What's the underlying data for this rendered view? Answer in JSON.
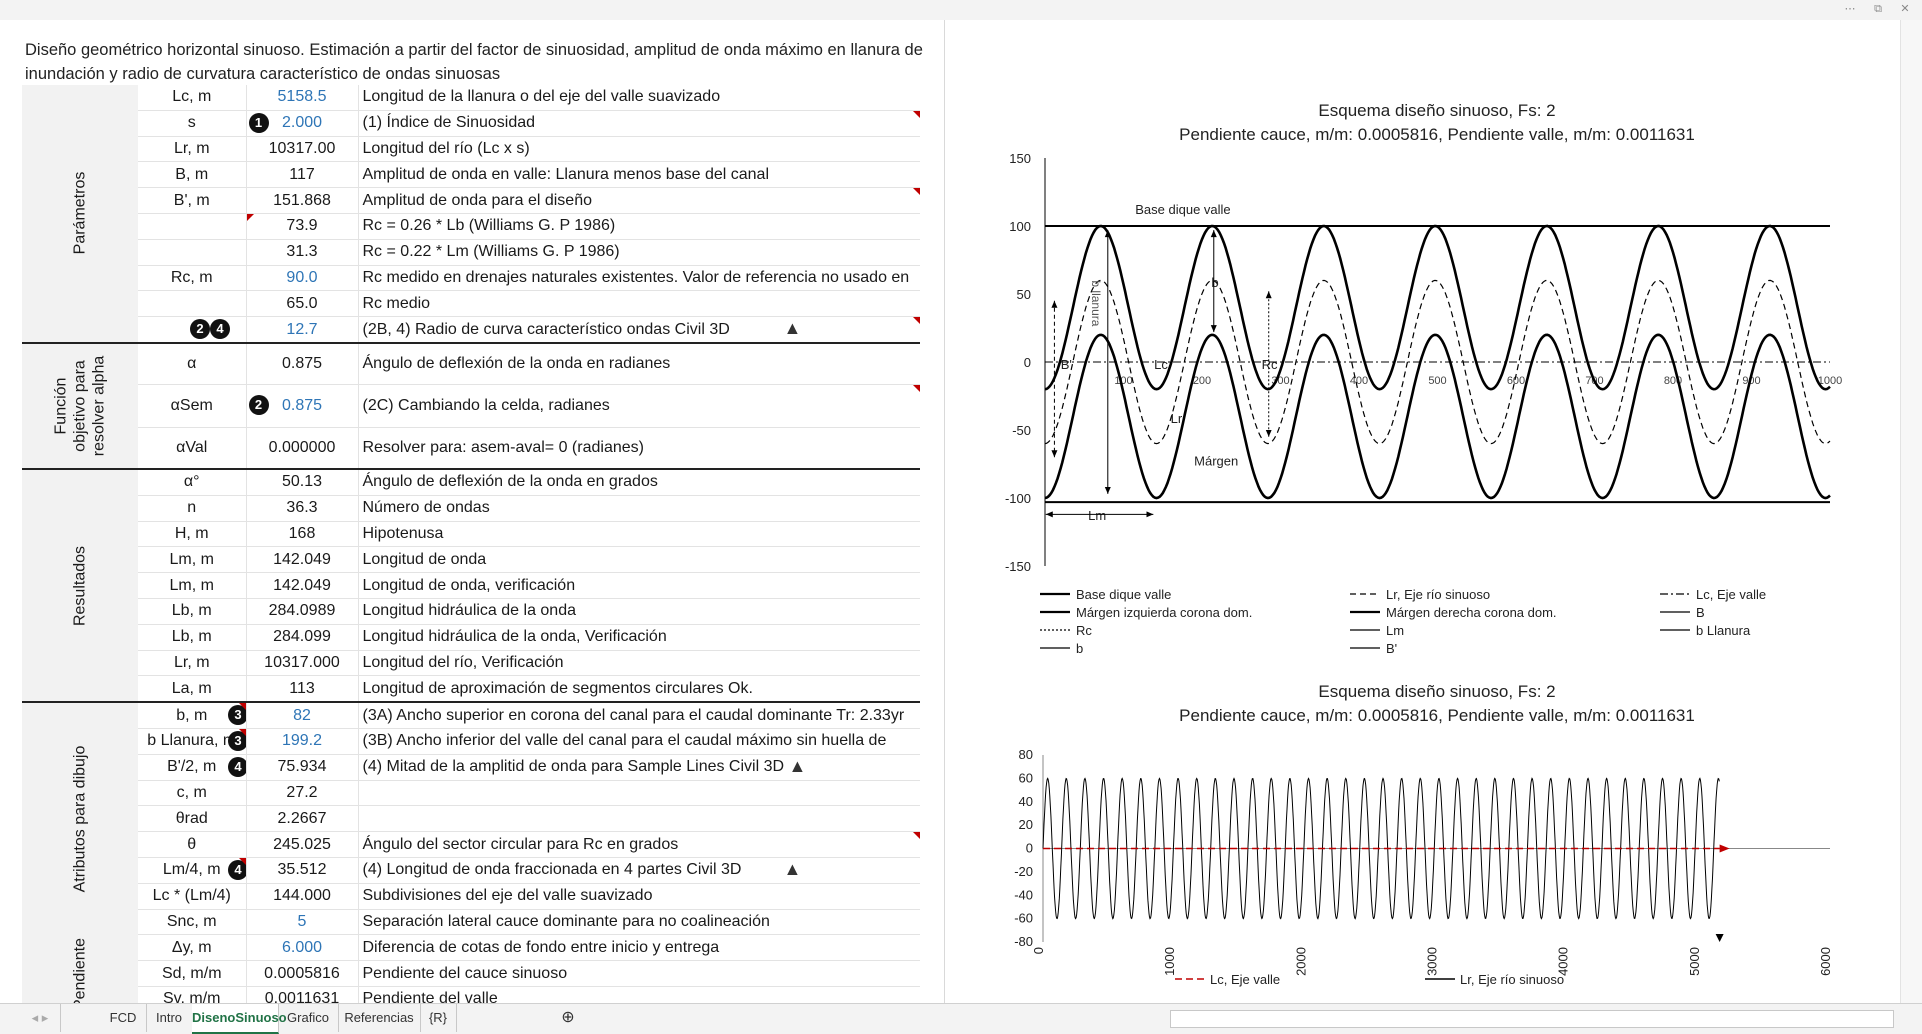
{
  "window": {
    "minimize": "⋯",
    "restore": "⧉",
    "close": "✕"
  },
  "title": "Diseño geométrico horizontal sinuoso. Estimación a partir del factor de sinuosidad, amplitud de onda máximo en llanura de inundación y radio de curvatura característico de ondas sinuosas",
  "sections": {
    "parametros": "Parámetros",
    "funcion": "Función objetivo para resolver alpha",
    "resultados": "Resultados",
    "atributos": "Atributos para dibujo",
    "pendiente": "Pendiente"
  },
  "rows": [
    {
      "label": "Lc, m",
      "value": "5158.5",
      "desc": "Longitud de la llanura o del eje del valle suavizado",
      "blue": true
    },
    {
      "label": "s",
      "value": "2.000",
      "desc": "(1) Índice de Sinuosidad",
      "blue": true,
      "mark": "1"
    },
    {
      "label": "Lr, m",
      "value": "10317.00",
      "desc": "Longitud del río (Lc x s)"
    },
    {
      "label": "B, m",
      "value": "117",
      "desc": "Amplitud de onda en valle: Llanura menos base del canal"
    },
    {
      "label": "B', m",
      "value": "151.868",
      "desc": "Amplitud de onda para el diseño"
    },
    {
      "label": "",
      "value": "73.9",
      "desc": "Rc = 0.26 * Lb (Williams G. P 1986)"
    },
    {
      "label": "",
      "value": "31.3",
      "desc": "Rc = 0.22 * Lm (Williams G. P 1986)"
    },
    {
      "label": "Rc, m",
      "value": "90.0",
      "desc": "Rc medido en drenajes naturales existentes. Valor de referencia no usado en",
      "blue": true
    },
    {
      "label": "",
      "value": "65.0",
      "desc": "Rc medio"
    },
    {
      "label": "",
      "value": "12.7",
      "desc": "(2B, 4) Radio de curva característico ondas Civil 3D",
      "blue": true,
      "mark": "2 4"
    },
    {
      "label": "α",
      "value": "0.875",
      "desc": "Ángulo de deflexión de la onda en radianes"
    },
    {
      "label": "αSem",
      "value": "0.875",
      "desc": "(2C) Cambiando la celda, radianes",
      "blue": true,
      "mark": "2"
    },
    {
      "label": "αVal",
      "value": "0.000000",
      "desc": "Resolver para: asem-aval= 0 (radianes)"
    },
    {
      "label": "α°",
      "value": "50.13",
      "desc": "Ángulo de deflexión de la onda en grados"
    },
    {
      "label": "n",
      "value": "36.3",
      "desc": "Número de ondas"
    },
    {
      "label": "H, m",
      "value": "168",
      "desc": "Hipotenusa"
    },
    {
      "label": "Lm, m",
      "value": "142.049",
      "desc": "Longitud de onda"
    },
    {
      "label": "Lm, m",
      "value": "142.049",
      "desc": "Longitud de onda, verificación"
    },
    {
      "label": "Lb, m",
      "value": "284.0989",
      "desc": "Longitud hidráulica de la onda"
    },
    {
      "label": "Lb, m",
      "value": "284.099",
      "desc": "Longitud hidráulica de la onda, Verificación"
    },
    {
      "label": "Lr, m",
      "value": "10317.000",
      "desc": "Longitud del río, Verificación"
    },
    {
      "label": "La, m",
      "value": "113",
      "desc": "Longitud de aproximación de segmentos circulares Ok."
    },
    {
      "label": "b, m",
      "value": "82",
      "desc": "(3A) Ancho superior en corona del canal para el caudal dominante Tr: 2.33yr",
      "blue": true,
      "mark": "3"
    },
    {
      "label": "b Llanura, m",
      "value": "199.2",
      "desc": "(3B) Ancho inferior del valle del canal para el caudal máximo sin huella de",
      "blue": true,
      "mark": "3"
    },
    {
      "label": "B'/2, m",
      "value": "75.934",
      "desc": "(4) Mitad de la amplitid de onda para Sample Lines Civil 3D",
      "mark": "4"
    },
    {
      "label": "c, m",
      "value": "27.2",
      "desc": ""
    },
    {
      "label": "θrad",
      "value": "2.2667",
      "desc": ""
    },
    {
      "label": "θ",
      "value": "245.025",
      "desc": "Ángulo del sector circular para Rc en grados"
    },
    {
      "label": "Lm/4, m",
      "value": "35.512",
      "desc": "(4) Longitud de onda fraccionada en 4 partes Civil 3D",
      "mark": "4"
    },
    {
      "label": "Lc * (Lm/4)",
      "value": "144.000",
      "desc": "Subdivisiones del eje del valle suavizado"
    },
    {
      "label": "Snc, m",
      "value": "5",
      "desc": "Separación lateral cauce dominante para no coalineación",
      "blue": true
    },
    {
      "label": "Δy, m",
      "value": "6.000",
      "desc": "Diferencia de cotas de fondo entre inicio y entrega",
      "blue": true
    },
    {
      "label": "Sd, m/m",
      "value": "0.0005816",
      "desc": "Pendiente del cauce sinuoso"
    },
    {
      "label": "Sv, m/m",
      "value": "0.0011631",
      "desc": "Pendiente del valle"
    }
  ],
  "chart_data": [
    {
      "type": "line",
      "title": "Esquema diseño sinuoso, Fs: 2",
      "subtitle": "Pendiente cauce, m/m: 0.0005816, Pendiente valle, m/m: 0.0011631",
      "xlim": [
        0,
        1000
      ],
      "ylim": [
        -150,
        150
      ],
      "xticks": [
        100,
        200,
        300,
        400,
        500,
        600,
        700,
        800,
        900,
        1000
      ],
      "xtick_labels": [
        "100",
        "200",
        "300",
        "400",
        "500",
        "600",
        "700",
        "800",
        "900",
        "1000"
      ],
      "yticks": [
        150,
        100,
        50,
        0,
        -50,
        -100,
        -150
      ],
      "annotations": [
        "Base dique valle",
        "b llanura",
        "b",
        "B'",
        "Lc",
        "Rc",
        "Lr",
        "Márgen",
        "Lm"
      ],
      "legend": [
        {
          "name": "Base dique valle",
          "style": "solid"
        },
        {
          "name": "Lr, Eje río sinuoso",
          "style": "dash-arrow"
        },
        {
          "name": "Lc, Eje valle",
          "style": "dashdot-arrow"
        },
        {
          "name": "Márgen izquierda corona dom.",
          "style": "solid"
        },
        {
          "name": "Márgen derecha corona dom.",
          "style": "solid"
        },
        {
          "name": "B",
          "style": "double-arrow"
        },
        {
          "name": "Rc",
          "style": "dotted"
        },
        {
          "name": "Lm",
          "style": "double-arrow"
        },
        {
          "name": "b Llanura",
          "style": "double-arrow"
        },
        {
          "name": "b",
          "style": "double-arrow"
        },
        {
          "name": "B'",
          "style": "double-arrow"
        }
      ],
      "series": [
        {
          "name": "Base dique valle",
          "values": [
            [
              0,
              100
            ],
            [
              1000,
              100
            ],
            [
              0,
              -103
            ],
            [
              1000,
              -103
            ]
          ]
        },
        {
          "name": "Lr, Eje río sinuoso",
          "amplitude": 60,
          "wavelength": 142.05,
          "offset": 0
        },
        {
          "name": "Lc, Eje valle",
          "values": [
            [
              0,
              0
            ],
            [
              1000,
              0
            ]
          ]
        },
        {
          "name": "Márgen izquierda corona dom.",
          "amplitude": 100,
          "wavelength": 142.05,
          "offset": -20
        },
        {
          "name": "Márgen derecha corona dom.",
          "amplitude": 100,
          "wavelength": 142.05,
          "offset": -80
        }
      ]
    },
    {
      "type": "line",
      "title": "Esquema diseño sinuoso, Fs: 2",
      "subtitle": "Pendiente cauce, m/m: 0.0005816, Pendiente valle, m/m: 0.0011631",
      "xlim": [
        0,
        6000
      ],
      "ylim": [
        -80,
        80
      ],
      "xticks": [
        0,
        1000,
        2000,
        3000,
        4000,
        5000,
        6000
      ],
      "xtick_labels": [
        "0",
        "1000",
        "2000",
        "3000",
        "4000",
        "5000",
        "6000"
      ],
      "yticks": [
        80,
        60,
        40,
        20,
        0,
        -20,
        -40,
        -60,
        -80
      ],
      "legend": [
        {
          "name": "Lc, Eje valle",
          "color": "#c00000"
        },
        {
          "name": "Lr, Eje río sinuoso",
          "color": "#000000"
        }
      ],
      "series": [
        {
          "name": "Lc, Eje valle",
          "values": [
            [
              0,
              0
            ],
            [
              5158.5,
              0
            ]
          ]
        },
        {
          "name": "Lr, Eje río sinuoso",
          "amplitude": 60,
          "wavelength": 142.05,
          "xmax": 5158.5
        }
      ]
    }
  ],
  "tabs": [
    "FCD",
    "Intro",
    "DisenoSinuoso",
    "Grafico",
    "Referencias",
    "{R}"
  ],
  "active_tab": "DisenoSinuoso",
  "colors": {
    "blue_value": "#2e75b6",
    "red_marker": "#c00000",
    "excel_green": "#217346"
  }
}
